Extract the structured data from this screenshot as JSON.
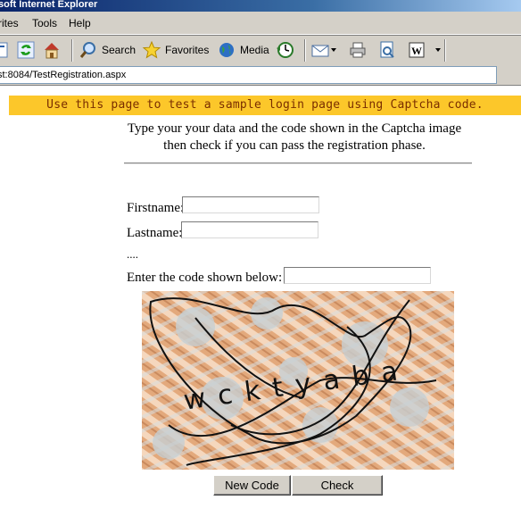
{
  "window": {
    "title": "soft Internet Explorer"
  },
  "menu": {
    "items": [
      "rites",
      "Tools",
      "Help"
    ]
  },
  "toolbar": {
    "search_label": "Search",
    "favorites_label": "Favorites",
    "media_label": "Media"
  },
  "address": {
    "url": "st:8084/TestRegistration.aspx"
  },
  "page": {
    "banner": "Use this page to test a sample login page using Captcha code.",
    "intro_line1": "Type your your data and the code shown in the Captcha image",
    "intro_line2": "then check if you can pass the registration phase.",
    "firstname_label": "Firstname:",
    "firstname_value": "",
    "lastname_label": "Lastname:",
    "lastname_value": "",
    "ellipsis": "....",
    "code_label": "Enter the code shown below:",
    "code_value": "",
    "captcha_text": "wcktyaba",
    "new_code_button": "New Code",
    "check_button": "Check"
  },
  "colors": {
    "banner_bg": "#fcc72a",
    "banner_text": "#7a2e00",
    "chrome": "#d4d0c8"
  }
}
